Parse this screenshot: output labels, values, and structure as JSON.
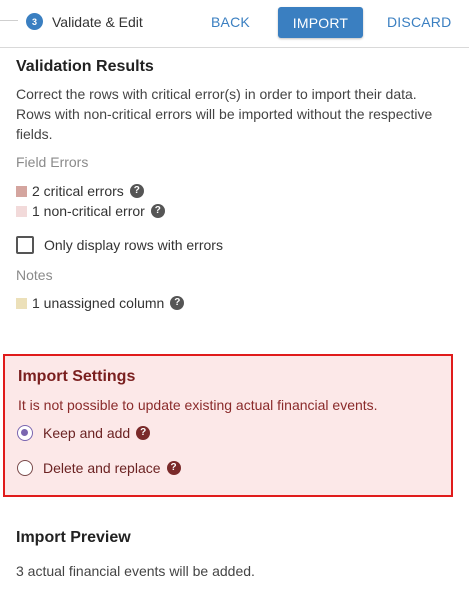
{
  "header": {
    "step_number": "3",
    "step_title": "Validate & Edit",
    "back_label": "BACK",
    "import_label": "IMPORT",
    "discard_label": "DISCARD"
  },
  "validation": {
    "title": "Validation Results",
    "description_line1": "Correct the rows with critical error(s) in order to import their data.",
    "description_line2": "Rows with non-critical errors will be imported without the respective",
    "description_line3": "fields.",
    "field_errors_label": "Field Errors",
    "critical_label": "2 critical errors",
    "noncritical_label": "1 non-critical error",
    "only_errors_label": "Only display rows with errors",
    "notes_label": "Notes",
    "unassigned_label": "1 unassigned column",
    "colors": {
      "critical": "#d4a59f",
      "noncritical": "#f2dada",
      "unassigned": "#ece0b9"
    }
  },
  "import_settings": {
    "title": "Import Settings",
    "message": "It is not possible to update existing actual financial events.",
    "options": [
      {
        "label": "Keep and add",
        "selected": true
      },
      {
        "label": "Delete and replace",
        "selected": false
      }
    ]
  },
  "preview": {
    "title": "Import Preview",
    "summary": "3 actual financial events will be added."
  },
  "icons": {
    "help": "?"
  }
}
